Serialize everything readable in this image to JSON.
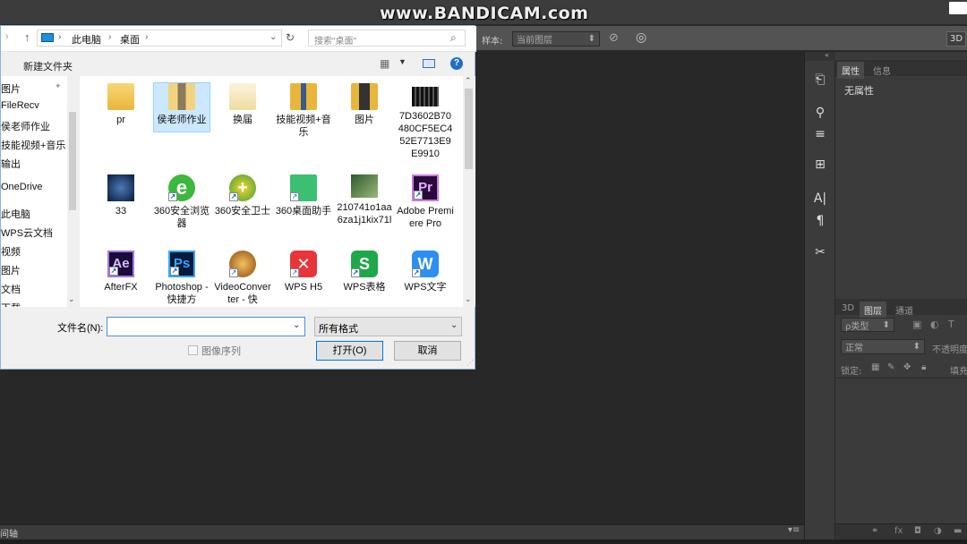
{
  "watermark": "www.BANDICAM.com",
  "photoshop": {
    "options_bar": {
      "sample_label": "样本:",
      "sample_value": "当前图层",
      "mode_3d": "3D"
    },
    "properties_tabs": [
      "属性",
      "信息"
    ],
    "properties_content": "无属性",
    "layers_tabs": [
      "3D",
      "图层",
      "通道"
    ],
    "layer_filter": "ρ类型",
    "blend_mode": "正常",
    "opacity_label": "不透明度",
    "lock_label": "锁定:",
    "fill_label": "填充",
    "timeline_label": "间轴"
  },
  "dialog": {
    "breadcrumb": [
      "此电脑",
      "桌面"
    ],
    "search_placeholder": "搜索\"桌面\"",
    "new_folder": "新建文件夹",
    "sidebar": [
      "图片",
      "FileRecv",
      "侯老师作业",
      "技能视频+音乐",
      "输出",
      "OneDrive",
      "此电脑",
      "WPS云文档",
      "视频",
      "图片",
      "文档",
      "下载"
    ],
    "files": [
      {
        "label": "pr",
        "icon": "folder"
      },
      {
        "label": "侯老师作业",
        "icon": "folder"
      },
      {
        "label": "换届",
        "icon": "folder"
      },
      {
        "label": "技能视频+音乐",
        "icon": "folder"
      },
      {
        "label": "图片",
        "icon": "folder"
      },
      {
        "label": "7D3602B70480CF5EC452E7713E9E9910",
        "icon": "video"
      },
      {
        "label": "33",
        "icon": "image"
      },
      {
        "label": "360安全浏览器",
        "icon": "360-browser"
      },
      {
        "label": "360安全卫士",
        "icon": "360-guard"
      },
      {
        "label": "360桌面助手",
        "icon": "360-desktop"
      },
      {
        "label": "210741o1aa6za1j1kix71l",
        "icon": "image"
      },
      {
        "label": "Adobe Premiere Pro",
        "icon": "premiere"
      },
      {
        "label": "AfterFX",
        "icon": "aftereffects"
      },
      {
        "label": "Photoshop - 快捷方",
        "icon": "photoshop"
      },
      {
        "label": "VideoConverter - 快",
        "icon": "videoconverter"
      },
      {
        "label": "WPS H5",
        "icon": "wps-h5"
      },
      {
        "label": "WPS表格",
        "icon": "wps-sheet"
      },
      {
        "label": "WPS文字",
        "icon": "wps-writer"
      }
    ],
    "filename_label": "文件名(N):",
    "filename_value": "",
    "filetype_value": "所有格式",
    "image_sequence_label": "图像序列",
    "open_button": "打开(O)",
    "cancel_button": "取消"
  }
}
